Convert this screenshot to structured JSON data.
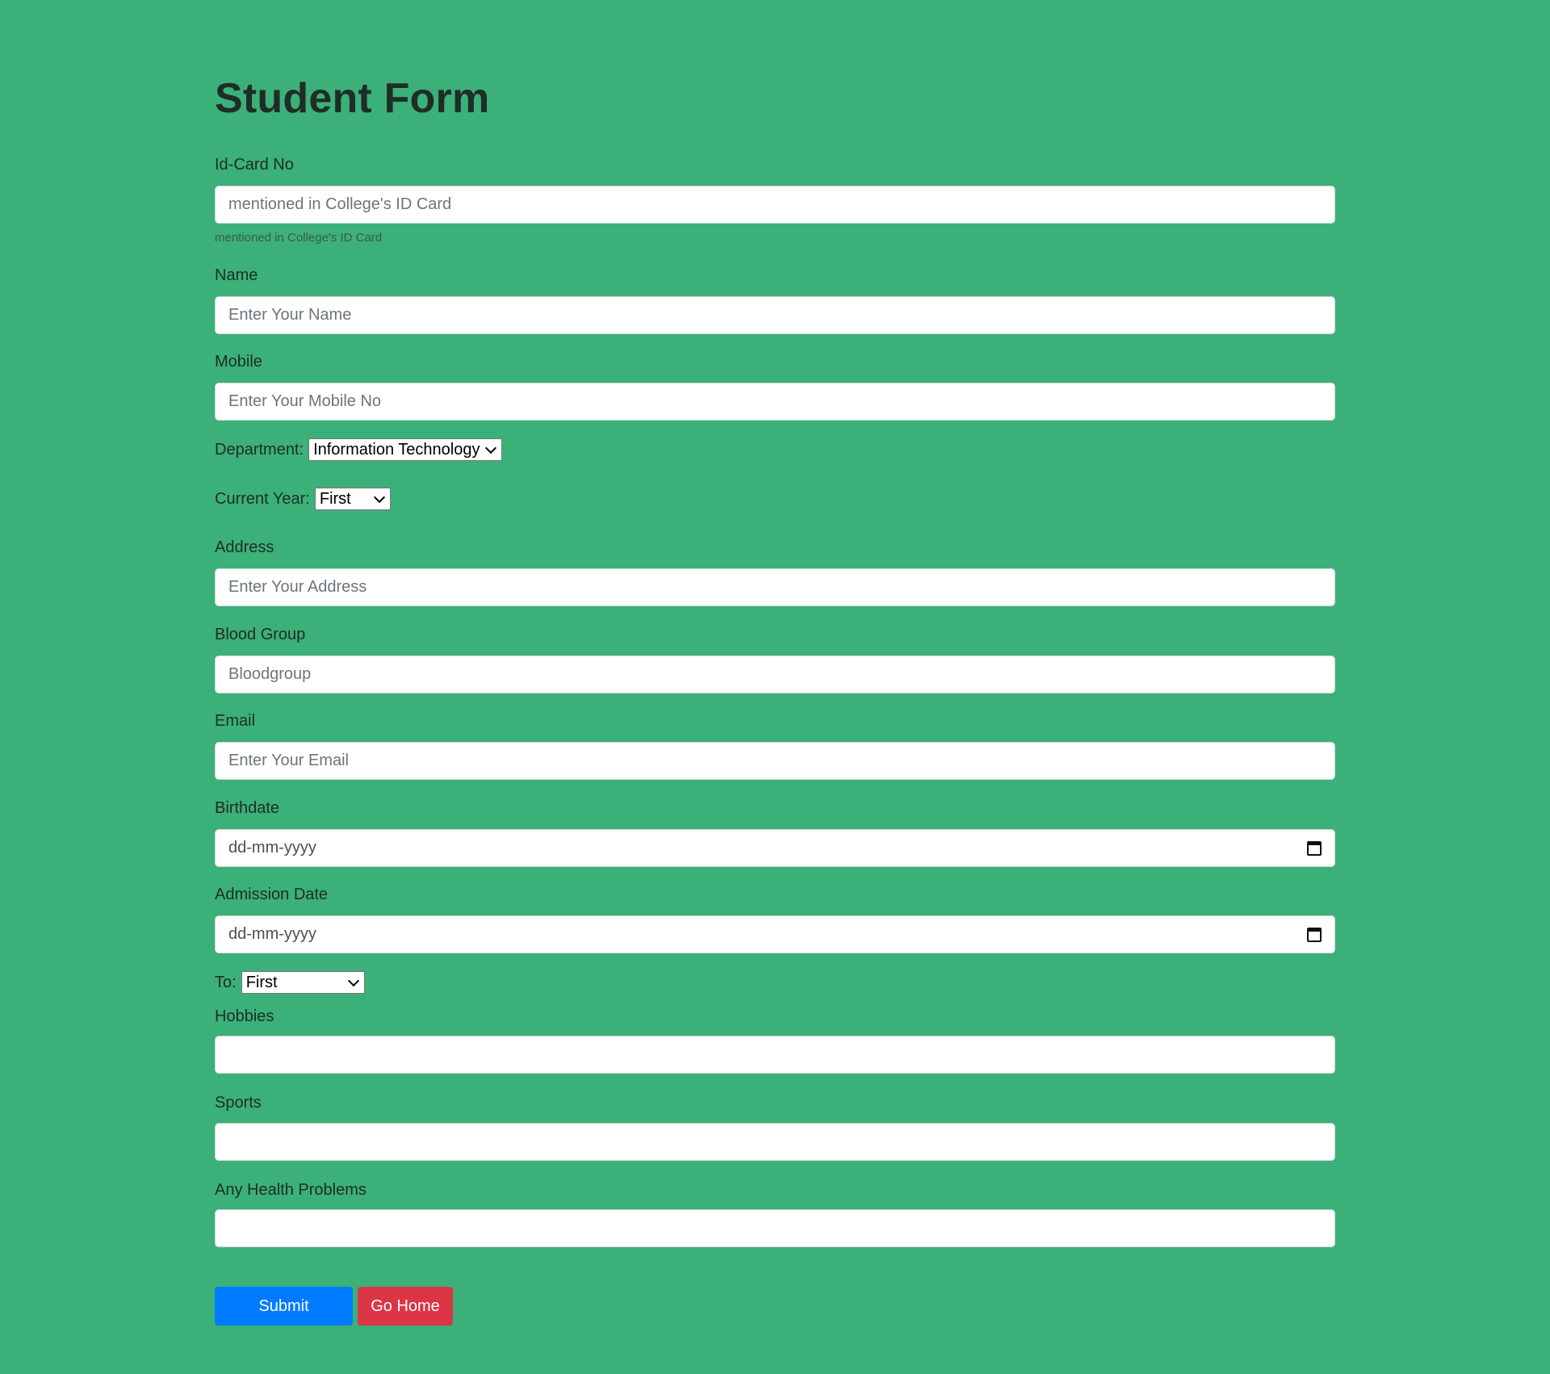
{
  "title": "Student Form",
  "id_card": {
    "label": "Id-Card No",
    "placeholder": "mentioned in College's ID Card",
    "help": "mentioned in College's ID Card"
  },
  "name": {
    "label": "Name",
    "placeholder": "Enter Your Name"
  },
  "mobile": {
    "label": "Mobile",
    "placeholder": "Enter Your Mobile No"
  },
  "department": {
    "label": "Department:",
    "selected": "Information Technology"
  },
  "current_year": {
    "label": "Current Year:",
    "selected": "First"
  },
  "address": {
    "label": "Address",
    "placeholder": "Enter Your Address"
  },
  "blood_group": {
    "label": "Blood Group",
    "placeholder": "Bloodgroup"
  },
  "email": {
    "label": "Email",
    "placeholder": "Enter Your Email"
  },
  "birthdate": {
    "label": "Birthdate",
    "placeholder": "dd-mm-yyyy",
    "icon": "calendar-icon"
  },
  "admission_date": {
    "label": "Admission Date",
    "placeholder": "dd-mm-yyyy",
    "icon": "calendar-icon"
  },
  "to": {
    "label": "To:",
    "selected": "First"
  },
  "hobbies": {
    "label": "Hobbies",
    "value": ""
  },
  "sports": {
    "label": "Sports",
    "value": ""
  },
  "health": {
    "label": "Any Health Problems",
    "value": ""
  },
  "buttons": {
    "submit": "Submit",
    "home": "Go Home"
  },
  "colors": {
    "background": "#3bb078",
    "submit": "#007bff",
    "home": "#dc3545"
  }
}
